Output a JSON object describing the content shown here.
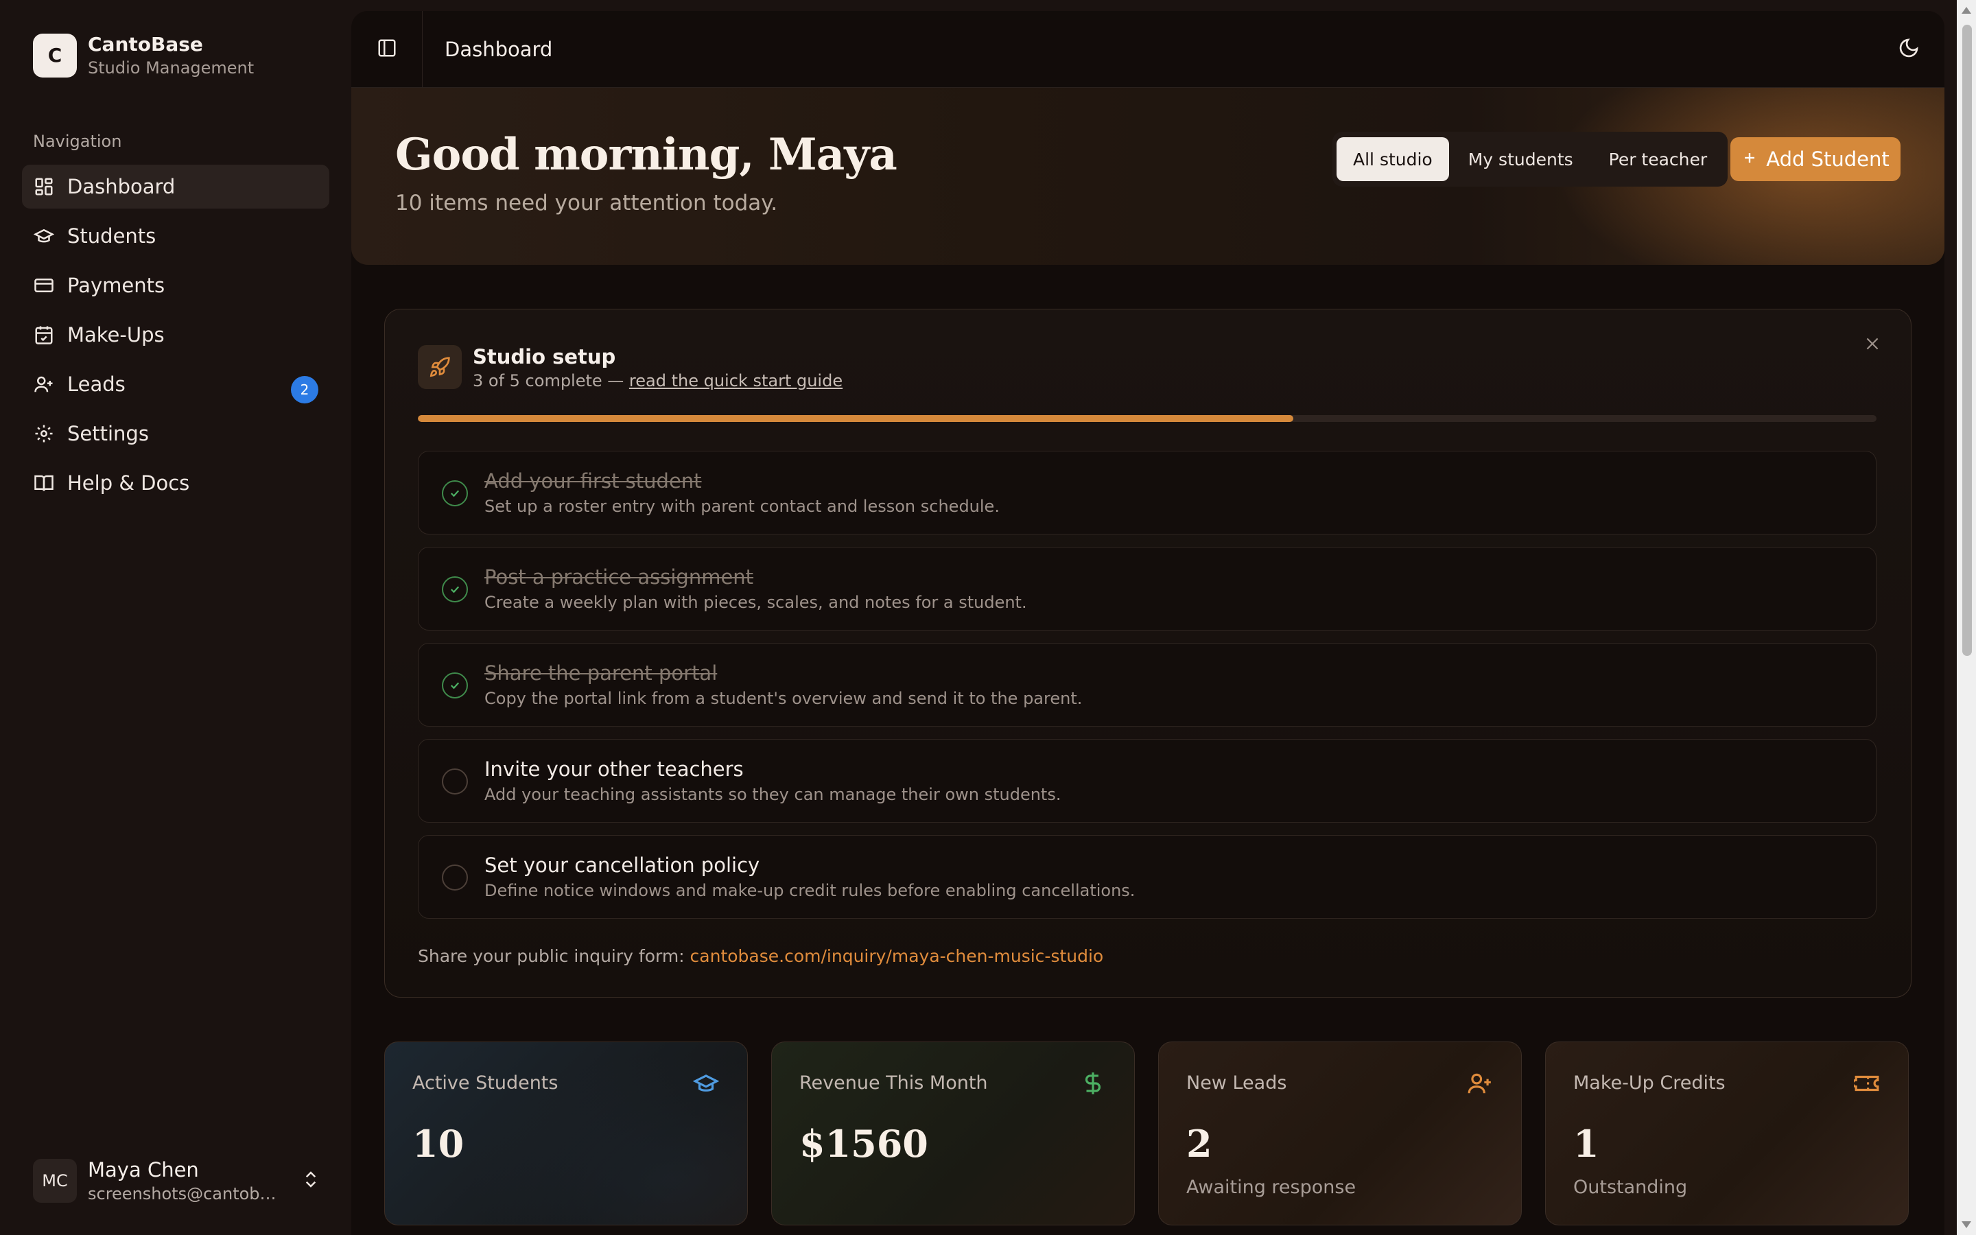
{
  "brand": {
    "logo_letter": "C",
    "name": "CantoBase",
    "subtitle": "Studio Management"
  },
  "nav": {
    "title": "Navigation",
    "items": [
      {
        "label": "Dashboard",
        "icon": "dashboard-icon",
        "active": true
      },
      {
        "label": "Students",
        "icon": "graduation-cap-icon"
      },
      {
        "label": "Payments",
        "icon": "credit-card-icon"
      },
      {
        "label": "Make-Ups",
        "icon": "calendar-check-icon"
      },
      {
        "label": "Leads",
        "icon": "user-plus-icon",
        "badge": "2"
      },
      {
        "label": "Settings",
        "icon": "gear-icon"
      },
      {
        "label": "Help & Docs",
        "icon": "book-icon"
      }
    ]
  },
  "user": {
    "initials": "MC",
    "name": "Maya Chen",
    "email": "screenshots@cantobase.com"
  },
  "topbar": {
    "title": "Dashboard"
  },
  "hero": {
    "greeting": "Good morning, Maya",
    "subtitle": "10 items need your attention today.",
    "segments": [
      "All studio",
      "My students",
      "Per teacher"
    ],
    "active_segment": "All studio",
    "add_button": "Add Student"
  },
  "setup": {
    "title": "Studio setup",
    "progress_text": "3 of 5 complete — ",
    "guide_link": "read the quick start guide",
    "progress_fraction": 0.6,
    "tasks": [
      {
        "title": "Add your first student",
        "desc": "Set up a roster entry with parent contact and lesson schedule.",
        "done": true
      },
      {
        "title": "Post a practice assignment",
        "desc": "Create a weekly plan with pieces, scales, and notes for a student.",
        "done": true
      },
      {
        "title": "Share the parent portal",
        "desc": "Copy the portal link from a student's overview and send it to the parent.",
        "done": true
      },
      {
        "title": "Invite your other teachers",
        "desc": "Add your teaching assistants so they can manage their own students.",
        "done": false
      },
      {
        "title": "Set your cancellation policy",
        "desc": "Define notice windows and make-up credit rules before enabling cancellations.",
        "done": false
      }
    ],
    "share_label": "Share your public inquiry form: ",
    "share_link": "cantobase.com/inquiry/maya-chen-music-studio"
  },
  "stats": [
    {
      "label": "Active Students",
      "value": "10",
      "note": "",
      "icon": "graduation-cap-icon",
      "color": "#4f9be0"
    },
    {
      "label": "Revenue This Month",
      "value": "$1560",
      "note": "",
      "icon": "dollar-icon",
      "color": "#4caf63"
    },
    {
      "label": "New Leads",
      "value": "2",
      "note": "Awaiting response",
      "icon": "user-plus-icon",
      "color": "#e08c3c"
    },
    {
      "label": "Make-Up Credits",
      "value": "1",
      "note": "Outstanding",
      "icon": "ticket-icon",
      "color": "#e08c3c"
    }
  ],
  "colors": {
    "accent": "#d5893b",
    "badge": "#2c7be5",
    "done": "#3f8a4b"
  }
}
